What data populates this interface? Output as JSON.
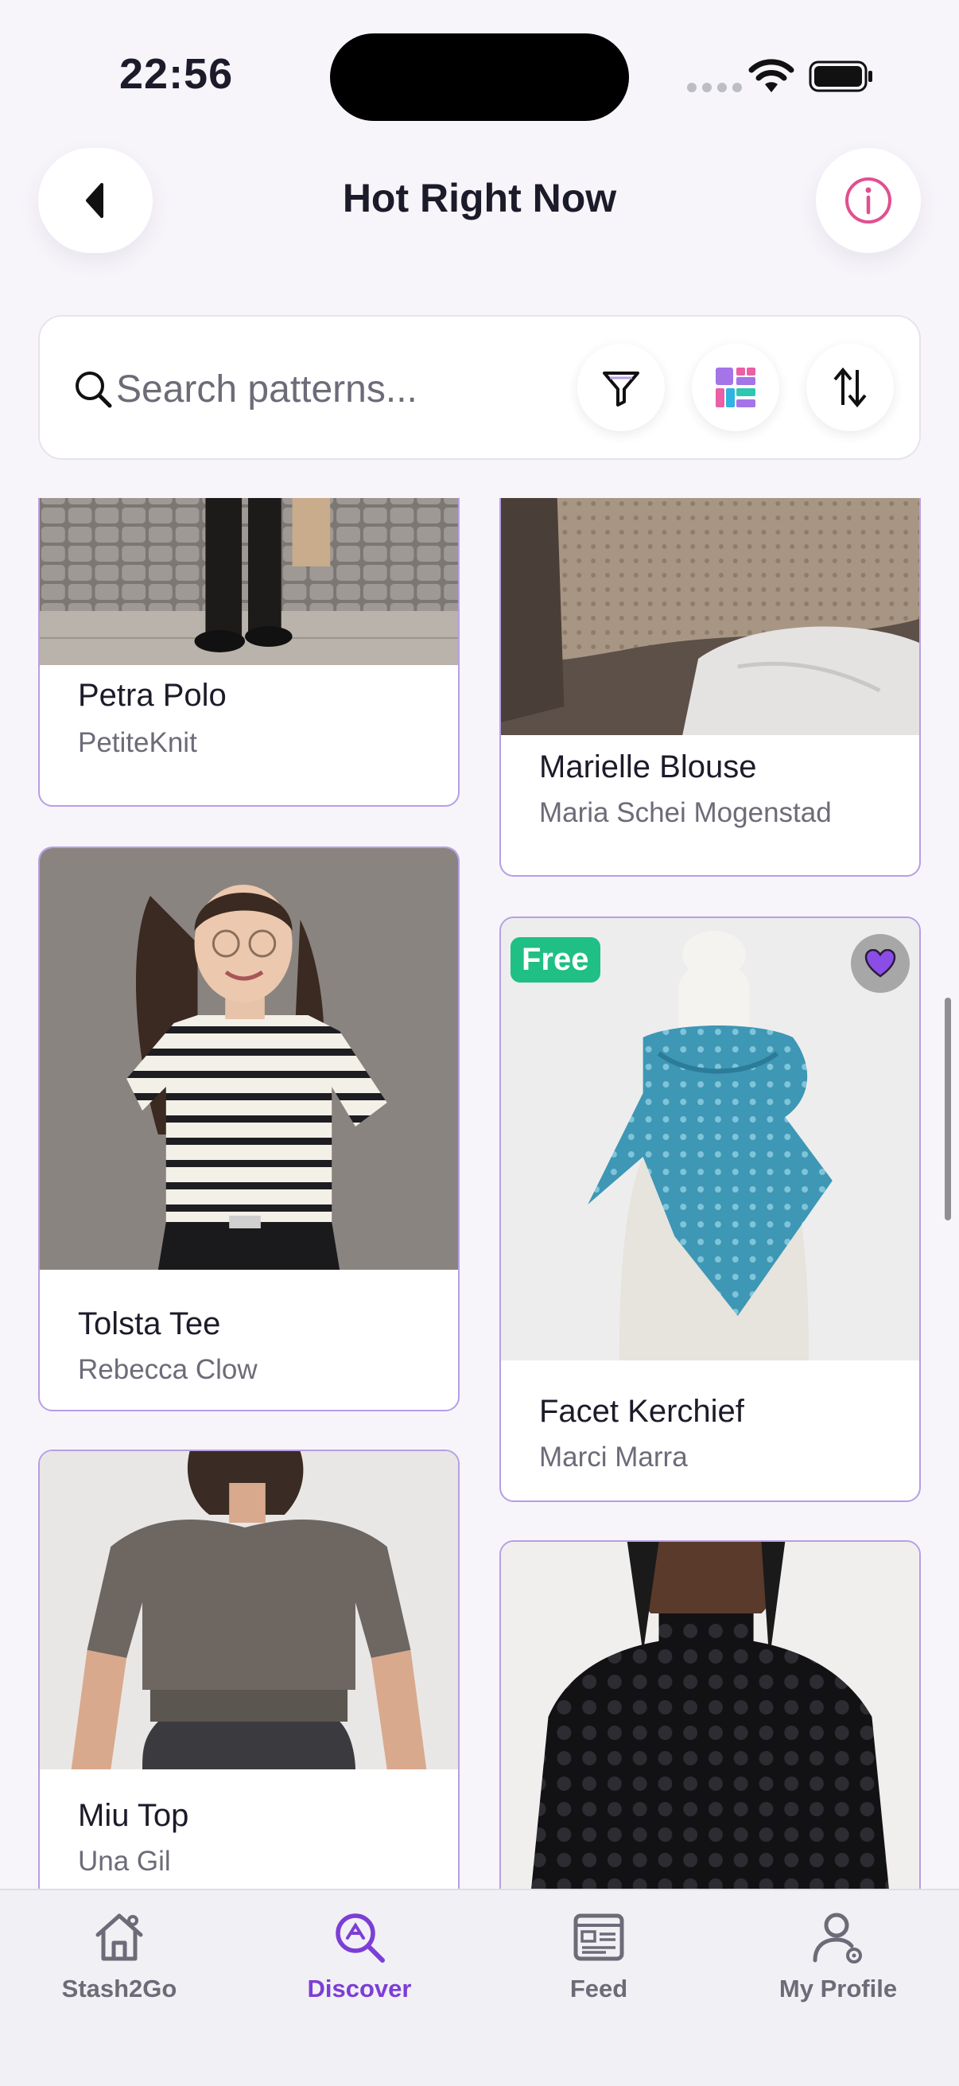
{
  "status_bar": {
    "time": "22:56"
  },
  "header": {
    "title": "Hot Right Now"
  },
  "search": {
    "placeholder": "Search patterns..."
  },
  "cards": [
    {
      "title": "Petra Polo",
      "author": "PetiteKnit"
    },
    {
      "title": "Marielle Blouse",
      "author": "Maria Schei Mogenstad"
    },
    {
      "title": "Tolsta Tee",
      "author": "Rebecca Clow"
    },
    {
      "title": "Facet Kerchief",
      "author": "Marci Marra",
      "badge": "Free",
      "favorited": true
    },
    {
      "title": "Miu Top",
      "author": "Una Gil"
    },
    {
      "title": "",
      "author": ""
    }
  ],
  "tabs": [
    {
      "label": "Stash2Go",
      "icon": "home-icon"
    },
    {
      "label": "Discover",
      "icon": "discover-icon",
      "active": true
    },
    {
      "label": "Feed",
      "icon": "feed-icon"
    },
    {
      "label": "My Profile",
      "icon": "profile-icon"
    }
  ],
  "colors": {
    "accent": "#7c3ed6",
    "info": "#e0508f",
    "free_badge": "#1fbf85",
    "card_border": "#b79ee6"
  }
}
